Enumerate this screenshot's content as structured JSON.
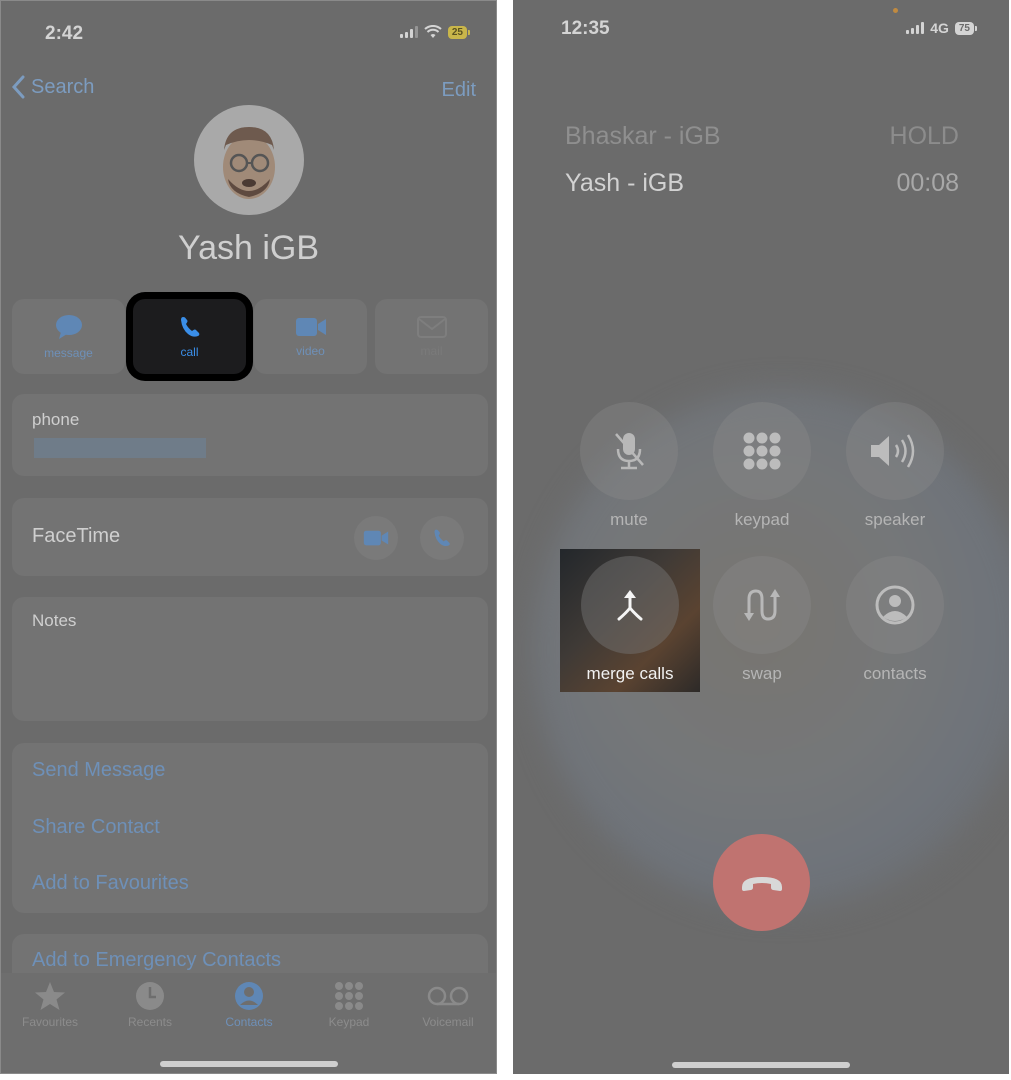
{
  "left": {
    "status_bar": {
      "time": "2:42",
      "battery": "25",
      "battery_color": "#c9b64a"
    },
    "nav": {
      "back_label": "Search",
      "edit_label": "Edit"
    },
    "contact": {
      "name": "Yash iGB",
      "avatar": "memoji-avatar"
    },
    "actions": [
      {
        "label": "message",
        "icon": "message-bubble-icon",
        "highlighted": false,
        "disabled": false
      },
      {
        "label": "call",
        "icon": "phone-icon",
        "highlighted": true,
        "disabled": false
      },
      {
        "label": "video",
        "icon": "video-camera-icon",
        "highlighted": false,
        "disabled": false
      },
      {
        "label": "mail",
        "icon": "envelope-icon",
        "highlighted": false,
        "disabled": true
      }
    ],
    "phone_card": {
      "label": "phone",
      "value": "[redacted]"
    },
    "facetime_card": {
      "label": "FaceTime"
    },
    "notes_card": {
      "label": "Notes"
    },
    "links": [
      "Send Message",
      "Share Contact",
      "Add to Favourites"
    ],
    "emergency_link": "Add to Emergency Contacts",
    "tabs": [
      {
        "label": "Favourites",
        "icon": "star-icon",
        "active": false
      },
      {
        "label": "Recents",
        "icon": "clock-icon",
        "active": false
      },
      {
        "label": "Contacts",
        "icon": "person-circle-icon",
        "active": true
      },
      {
        "label": "Keypad",
        "icon": "keypad-icon",
        "active": false
      },
      {
        "label": "Voicemail",
        "icon": "voicemail-icon",
        "active": false
      }
    ],
    "accent_color": "#3a8ee8"
  },
  "right": {
    "status_bar": {
      "time": "12:35",
      "network": "4G",
      "battery": "75",
      "battery_color": "#d4d4d4"
    },
    "calls": [
      {
        "name": "Bhaskar - iGB",
        "status": "HOLD"
      },
      {
        "name": "Yash - iGB",
        "status": "00:08"
      }
    ],
    "controls": [
      {
        "label": "mute",
        "icon": "mic-slash-icon"
      },
      {
        "label": "keypad",
        "icon": "keypad-icon"
      },
      {
        "label": "speaker",
        "icon": "speaker-icon"
      },
      {
        "label": "merge calls",
        "icon": "merge-arrow-icon",
        "highlighted": true
      },
      {
        "label": "swap",
        "icon": "swap-arrows-icon"
      },
      {
        "label": "contacts",
        "icon": "person-circle-icon"
      }
    ],
    "end_call_color": "#c07370"
  }
}
